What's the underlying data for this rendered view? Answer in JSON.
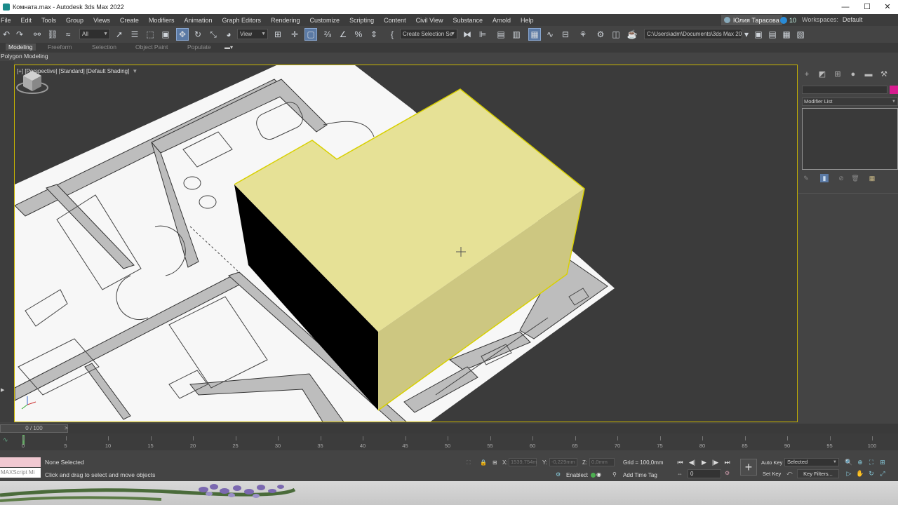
{
  "window": {
    "title": "Комната.max - Autodesk 3ds Max 2022",
    "controls": [
      "—",
      "☐",
      "✕"
    ]
  },
  "menu": {
    "items": [
      "File",
      "Edit",
      "Tools",
      "Group",
      "Views",
      "Create",
      "Modifiers",
      "Animation",
      "Graph Editors",
      "Rendering",
      "Customize",
      "Scripting",
      "Content",
      "Civil View",
      "Substance",
      "Arnold",
      "Help"
    ],
    "user": "Юлия Тарасова",
    "notifications": "10",
    "workspaces_label": "Workspaces:",
    "workspace_value": "Default"
  },
  "toolbar": {
    "filter_value": "All",
    "refcoord_value": "View",
    "selection_set_placeholder": "Create Selection Se",
    "project_path": "C:\\Users\\adm\\Documents\\3ds Max 2022"
  },
  "ribbon": {
    "tabs": [
      "Modeling",
      "Freeform",
      "Selection",
      "Object Paint",
      "Populate"
    ],
    "active_tab": "Modeling",
    "sub_label": "Polygon Modeling"
  },
  "viewport": {
    "label": "[+] [Perspective] [Standard] [Default Shading]",
    "filter_icon": "filter-icon",
    "box_color": "#e6e196",
    "selection_color": "#d8d000"
  },
  "command_panel": {
    "tabs": [
      "create-icon",
      "modify-icon",
      "hierarchy-icon",
      "motion-icon",
      "display-icon",
      "utilities-icon"
    ],
    "object_color": "#d81b8f",
    "modifier_list": "Modifier List"
  },
  "timeline": {
    "slider_label": "0 / 100",
    "ticks": [
      "0",
      "5",
      "10",
      "15",
      "20",
      "25",
      "30",
      "35",
      "40",
      "45",
      "50",
      "55",
      "60",
      "65",
      "70",
      "75",
      "80",
      "85",
      "90",
      "95",
      "100"
    ]
  },
  "status": {
    "maxscript_label": "MAXScript Mi",
    "selection": "None Selected",
    "prompt": "Click and drag to select and move objects",
    "x_label": "X:",
    "x_value": "1539,754m",
    "y_label": "Y:",
    "y_value": "-0,229mm",
    "z_label": "Z:",
    "z_value": "0,0mm",
    "grid": "Grid = 100,0mm",
    "enabled_label": "Enabled:",
    "add_time_tag": "Add Time Tag",
    "frame_value": "0",
    "auto_key": "Auto Key",
    "set_key": "Set Key",
    "key_mode": "Selected",
    "key_filters": "Key Filters..."
  }
}
